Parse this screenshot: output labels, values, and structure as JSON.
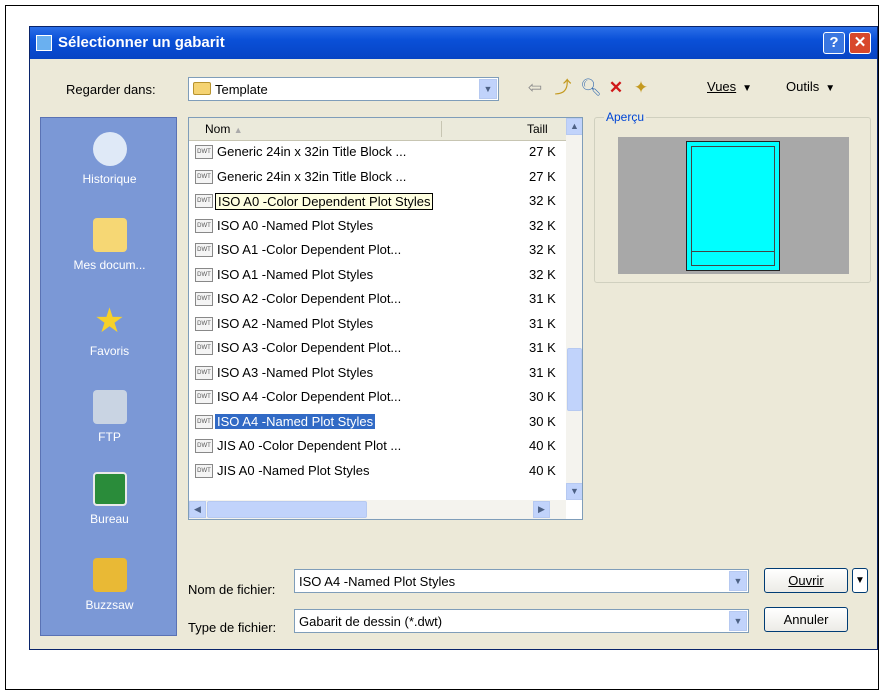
{
  "dialog": {
    "title": "Sélectionner un gabarit",
    "help_label": "?",
    "close_label": "✕"
  },
  "look_in": {
    "label": "Regarder dans:",
    "value": "Template"
  },
  "toolbar": {
    "back_icon": "back-arrow-icon",
    "up_icon": "folder-up-icon",
    "search_icon": "search-web-icon",
    "delete_icon": "delete-icon",
    "new_folder_icon": "new-folder-icon",
    "views_label": "Vues",
    "tools_label": "Outils"
  },
  "places": {
    "items": [
      {
        "label": "Historique",
        "icon": "history-icon"
      },
      {
        "label": "Mes docum...",
        "icon": "my-documents-icon"
      },
      {
        "label": "Favoris",
        "icon": "favorites-star-icon"
      },
      {
        "label": "FTP",
        "icon": "ftp-icon"
      },
      {
        "label": "Bureau",
        "icon": "desktop-icon"
      },
      {
        "label": "Buzzsaw",
        "icon": "buzzsaw-icon"
      }
    ]
  },
  "file_list": {
    "columns": {
      "name": "Nom",
      "size": "Taill"
    },
    "sort_indicator": "▲",
    "rows": [
      {
        "name": "Generic 24in x 32in Title Block ...",
        "size": "27 K",
        "icon_text": "DWT"
      },
      {
        "name": "Generic 24in x 32in Title Block ...",
        "size": "27 K",
        "icon_text": "DWT"
      },
      {
        "name": "ISO A0 -Color Dependent Plot Styles",
        "size": "32 K",
        "icon_text": "DWT"
      },
      {
        "name": "ISO A0 -Named Plot Styles",
        "size": "32 K",
        "icon_text": "DWT"
      },
      {
        "name": "ISO A1 -Color Dependent Plot...",
        "size": "32 K",
        "icon_text": "DWT"
      },
      {
        "name": "ISO A1 -Named Plot Styles",
        "size": "32 K",
        "icon_text": "DWT"
      },
      {
        "name": "ISO A2 -Color Dependent Plot...",
        "size": "31 K",
        "icon_text": "DWT"
      },
      {
        "name": "ISO A2 -Named Plot Styles",
        "size": "31 K",
        "icon_text": "DWT"
      },
      {
        "name": "ISO A3 -Color Dependent Plot...",
        "size": "31 K",
        "icon_text": "DWT"
      },
      {
        "name": "ISO A3 -Named Plot Styles",
        "size": "31 K",
        "icon_text": "DWT"
      },
      {
        "name": "ISO A4 -Color Dependent Plot...",
        "size": "30 K",
        "icon_text": "DWT"
      },
      {
        "name": "ISO A4 -Named Plot Styles",
        "size": "30 K",
        "icon_text": "DWT"
      },
      {
        "name": "JIS A0 -Color Dependent Plot ...",
        "size": "40 K",
        "icon_text": "DWT"
      },
      {
        "name": "JIS A0 -Named Plot Styles",
        "size": "40 K",
        "icon_text": "DWT"
      }
    ],
    "selected_index": 11,
    "tooltip_index": 2,
    "scroll_labels": {
      "up": "▲",
      "down": "▼",
      "left": "◀",
      "right": "▶"
    }
  },
  "preview": {
    "label": "Aperçu",
    "sheet_color": "#00ffff"
  },
  "filename": {
    "label": "Nom de fichier:",
    "value": "ISO A4 -Named Plot Styles"
  },
  "filetype": {
    "label": "Type de fichier:",
    "value": "Gabarit de dessin (*.dwt)"
  },
  "buttons": {
    "open": "Ouvrir",
    "cancel": "Annuler",
    "open_split": "▼"
  },
  "colors": {
    "title_bar": "#0a50d8",
    "places_bg": "#7b98d6",
    "selection": "#316ac5",
    "dialog_bg": "#ece9d8"
  }
}
